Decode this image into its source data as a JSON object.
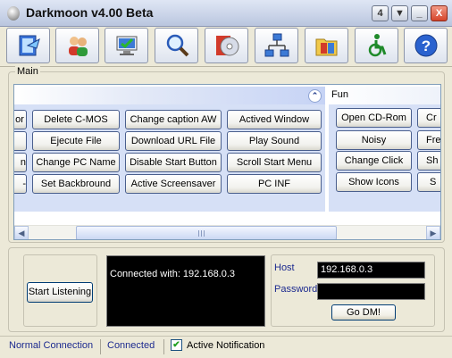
{
  "window": {
    "title": "Darkmoon v4.00 Beta",
    "controls": [
      {
        "name": "pin-button",
        "glyph": "4",
        "icon": "pin-icon"
      },
      {
        "name": "down-button",
        "glyph": "▼",
        "icon": "arrow-down-icon"
      },
      {
        "name": "minimize-button",
        "glyph": "_",
        "icon": "minimize-icon"
      },
      {
        "name": "close-button",
        "glyph": "X",
        "icon": "close-icon"
      }
    ]
  },
  "toolbar": {
    "items": [
      "connect-icon",
      "users-icon",
      "computer-icon",
      "search-icon",
      "disc-icon",
      "network-icon",
      "files-icon",
      "accessibility-icon",
      "help-icon"
    ]
  },
  "main": {
    "legend": "Main",
    "group_buttons": [
      [
        "or",
        "Delete C-MOS",
        "Change caption  AW",
        "Actived Window"
      ],
      [
        "",
        "Ejecute File",
        "Download URL File",
        "Play Sound"
      ],
      [
        "n",
        "Change PC Name",
        "Disable Start Button",
        "Scroll Start Menu"
      ],
      [
        "-",
        "Set Backbround",
        "Active Screensaver",
        "PC INF"
      ]
    ],
    "fun": {
      "title": "Fun",
      "buttons": [
        [
          "Open CD-Rom",
          "Cr"
        ],
        [
          "Noisy",
          "Fre"
        ],
        [
          "Change Click",
          "Sh"
        ],
        [
          "Show Icons",
          "S"
        ]
      ]
    },
    "scrollbar_grip": "III"
  },
  "lower": {
    "listen_label": "Start Listening",
    "console_text": "Connected with: 192.168.0.3",
    "host_label": "Host",
    "host_value": "192.168.0.3",
    "password_label": "Password",
    "password_value": "",
    "go_label": "Go DM!"
  },
  "status": {
    "connection_type": "Normal Connection",
    "state": "Connected",
    "notification_label": "Active Notification",
    "notification_checked": true
  },
  "colors": {
    "accent_text": "#1c2a8f",
    "panel_fill": "#d6e0f6",
    "console_bg": "#000000"
  }
}
